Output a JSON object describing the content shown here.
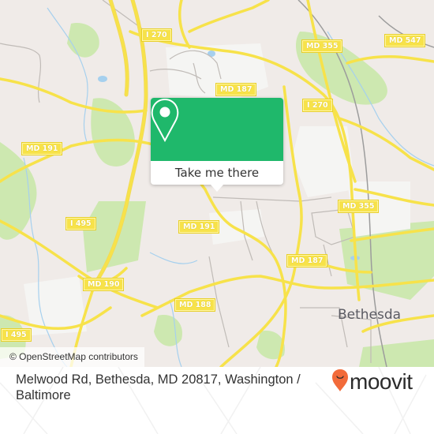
{
  "map": {
    "attribution": "© OpenStreetMap contributors",
    "colors": {
      "background": "#f0ebe8",
      "park": "#cde8b0",
      "highway": "#f7e24a",
      "water": "#a6d0ee",
      "minor_road": "#b8b4b0"
    },
    "road_shields": [
      {
        "id": "i270-north",
        "label": "I 270"
      },
      {
        "id": "md355-north",
        "label": "MD 355"
      },
      {
        "id": "md547",
        "label": "MD 547"
      },
      {
        "id": "md187-north",
        "label": "MD 187"
      },
      {
        "id": "i270-east",
        "label": "I 270"
      },
      {
        "id": "md191-west",
        "label": "MD 191"
      },
      {
        "id": "i495-center",
        "label": "I 495"
      },
      {
        "id": "md191-center",
        "label": "MD 191"
      },
      {
        "id": "md355-south",
        "label": "MD 355"
      },
      {
        "id": "md187-south",
        "label": "MD 187"
      },
      {
        "id": "md190",
        "label": "MD 190"
      },
      {
        "id": "md188",
        "label": "MD 188"
      },
      {
        "id": "i495-southwest",
        "label": "I 495"
      }
    ],
    "place_labels": [
      {
        "label": "Bethesda"
      }
    ]
  },
  "popup": {
    "icon": "map-pin-icon",
    "button_label": "Take me there",
    "accent_color": "#1fb86b"
  },
  "footer": {
    "address": "Melwood Rd, Bethesda, MD 20817, Washington / Baltimore",
    "logo": {
      "icon": "moovit-pin-icon",
      "text": "moovit",
      "icon_color": "#f26b3a"
    }
  }
}
